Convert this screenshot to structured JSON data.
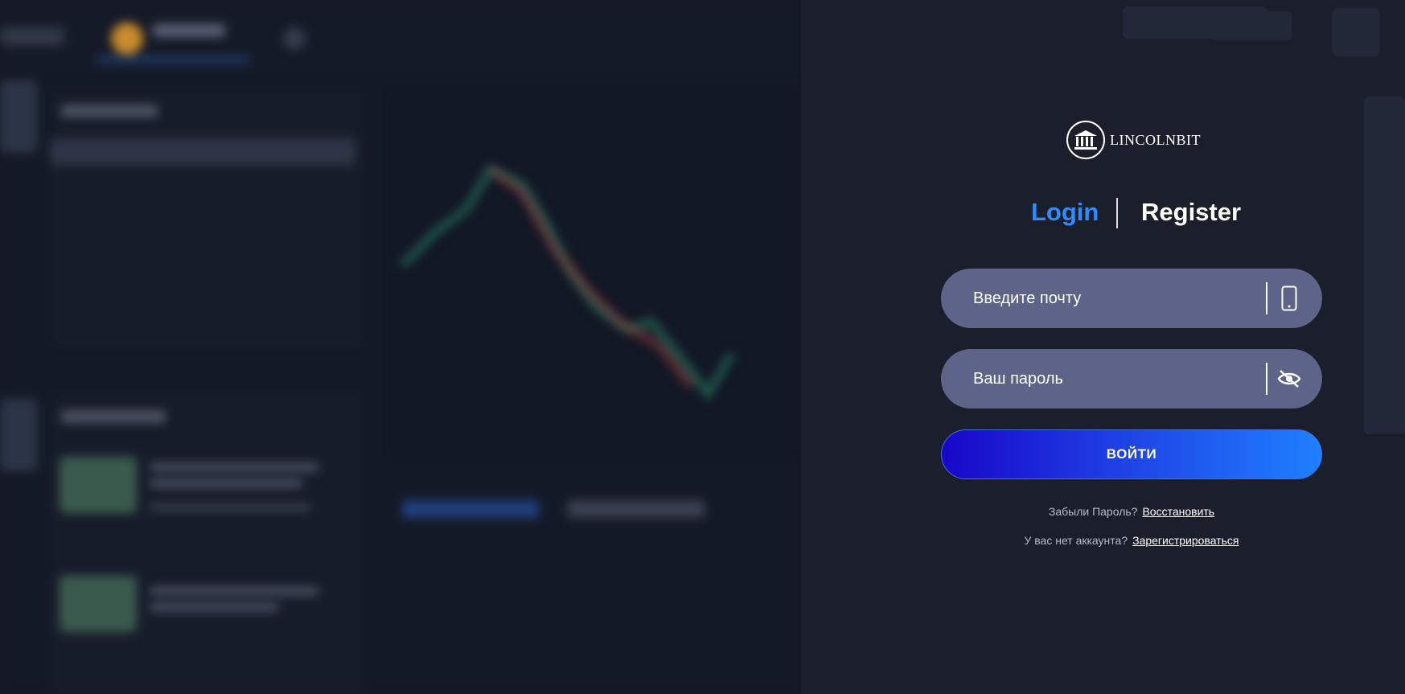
{
  "logo": {
    "text": "LINCOLNBIT",
    "icon": "bank-building-icon"
  },
  "tabs": {
    "login": "Login",
    "register": "Register",
    "active": "login"
  },
  "form": {
    "email_placeholder": "Введите почту",
    "email_icon": "phone-icon",
    "password_placeholder": "Ваш пароль",
    "password_icon": "eye-off-icon",
    "submit_label": "ВОЙТИ"
  },
  "help": {
    "forgot_text": "Забыли Пароль?",
    "forgot_link": "Восстановить",
    "no_account_text": "У вас нет аккаунта?",
    "register_link": "Зарегистрироваться"
  },
  "colors": {
    "accent": "#2d8cff",
    "field_bg": "#5d6487",
    "button_gradient_start": "#1906c9",
    "button_gradient_end": "#1f80ff",
    "background": "#1b1f2b"
  }
}
